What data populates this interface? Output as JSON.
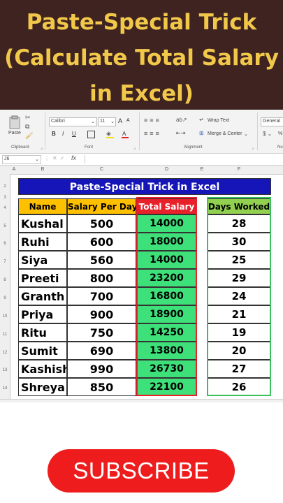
{
  "banner": {
    "line1": "Paste-Special Trick",
    "line2": "(Calculate Total Salary",
    "line3": "in Excel)",
    "text_color": "#f2c84b",
    "bg_color": "#3e2320"
  },
  "ribbon": {
    "clipboard": {
      "paste_label": "Paste",
      "group_label": "Clipboard"
    },
    "font": {
      "family": "Calibri",
      "size": "11",
      "bold": "B",
      "italic": "I",
      "underline": "U",
      "grow": "A",
      "shrink": "A",
      "font_color": "A",
      "group_label": "Font"
    },
    "alignment": {
      "wrap_text": "Wrap Text",
      "merge_center": "Merge & Center",
      "group_label": "Alignment"
    },
    "number": {
      "format": "General",
      "percent": "%",
      "group_label": "Nu"
    }
  },
  "formula_bar": {
    "name_box": "J6",
    "fx": "fx"
  },
  "columns": [
    "A",
    "B",
    "C",
    "D",
    "E",
    "F"
  ],
  "rows": [
    "2",
    "3",
    "4",
    "5",
    "6",
    "7",
    "8",
    "9",
    "10",
    "11",
    "12",
    "13",
    "14"
  ],
  "sheet": {
    "title": "Paste-Special Trick in Excel",
    "headers": {
      "name": "Name",
      "salary": "Salary Per Day",
      "total": "Total Salary",
      "days": "Days Worked"
    },
    "records": [
      {
        "name": "Kushal",
        "salary": "500",
        "total": "14000",
        "days": "28"
      },
      {
        "name": "Ruhi",
        "salary": "600",
        "total": "18000",
        "days": "30"
      },
      {
        "name": "Siya",
        "salary": "560",
        "total": "14000",
        "days": "25"
      },
      {
        "name": "Preeti",
        "salary": "800",
        "total": "23200",
        "days": "29"
      },
      {
        "name": "Granth",
        "salary": "700",
        "total": "16800",
        "days": "24"
      },
      {
        "name": "Priya",
        "salary": "900",
        "total": "18900",
        "days": "21"
      },
      {
        "name": "Ritu",
        "salary": "750",
        "total": "14250",
        "days": "19"
      },
      {
        "name": "Sumit",
        "salary": "690",
        "total": "13800",
        "days": "20"
      },
      {
        "name": "Kashish",
        "salary": "990",
        "total": "26730",
        "days": "27"
      },
      {
        "name": "Shreya",
        "salary": "850",
        "total": "22100",
        "days": "26"
      }
    ],
    "colors": {
      "title_bg": "#1515b8",
      "header_bg": "#ffc000",
      "total_header_bg": "#e8202a",
      "total_cell_bg": "#3ee07a",
      "days_header_bg": "#92d050"
    }
  },
  "subscribe": {
    "label": "SUBSCRIBE",
    "color": "#ee1c1c"
  }
}
